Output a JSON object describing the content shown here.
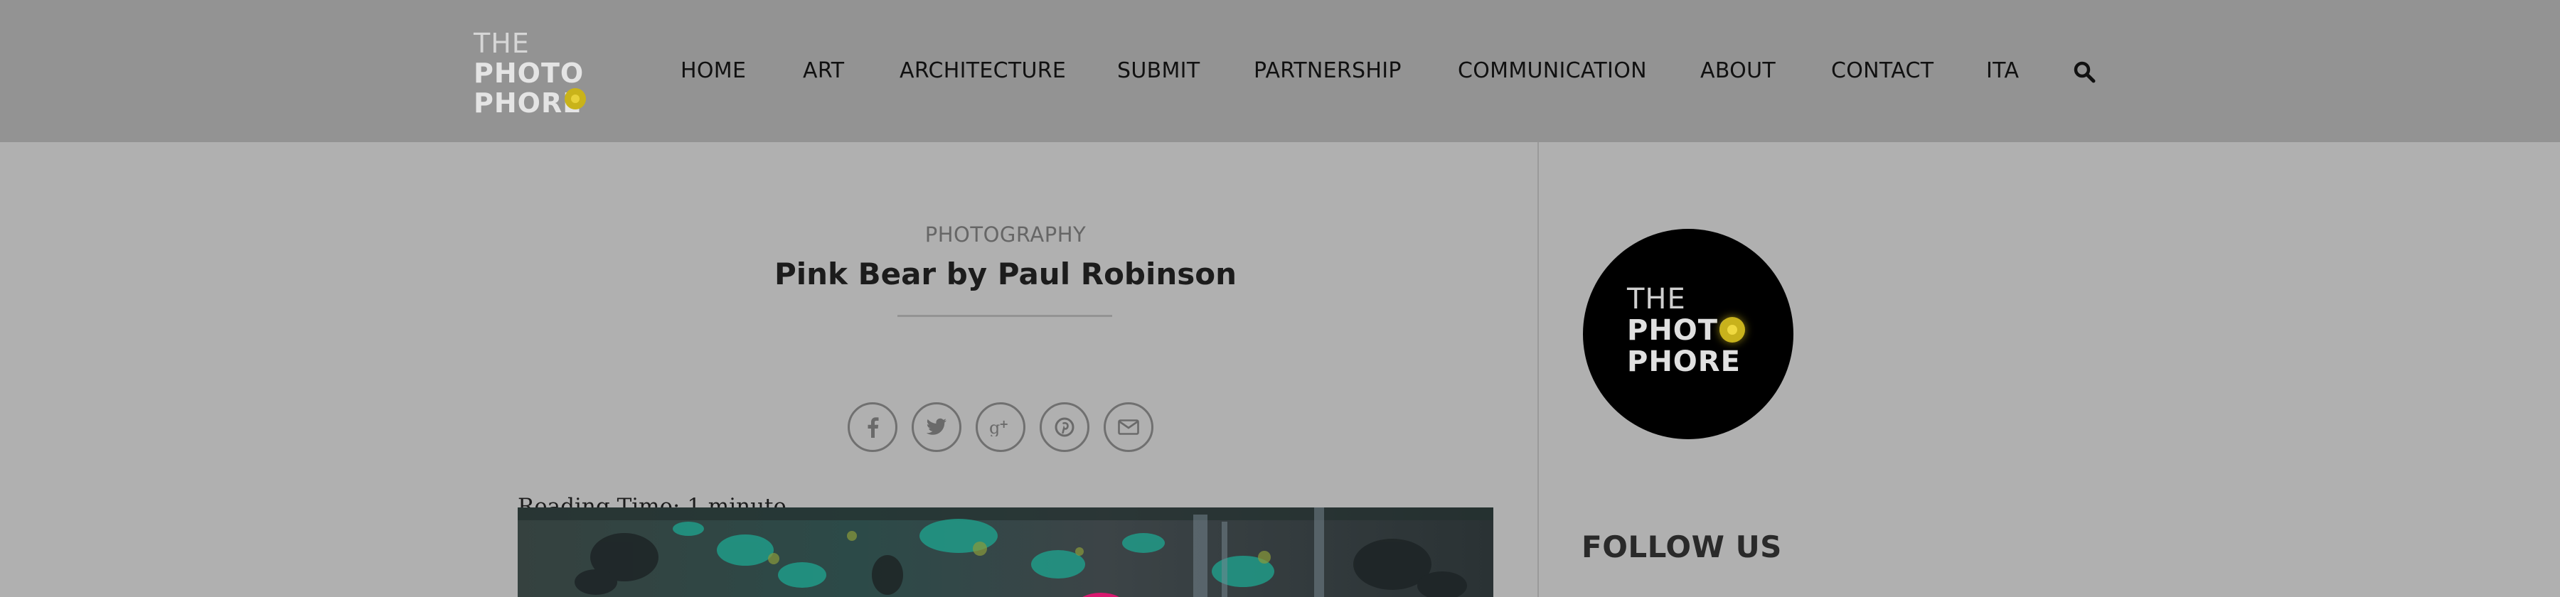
{
  "header": {
    "logo": {
      "line1": "THE",
      "line2": "PHOTO",
      "line3": "PHORE",
      "accent": "#c9b31a"
    },
    "nav": [
      {
        "label": "HOME"
      },
      {
        "label": "ART"
      },
      {
        "label": "ARCHITECTURE"
      },
      {
        "label": "SUBMIT"
      },
      {
        "label": "PARTNERSHIP"
      },
      {
        "label": "COMMUNICATION"
      },
      {
        "label": "ABOUT"
      },
      {
        "label": "CONTACT"
      },
      {
        "label": "ITA"
      }
    ],
    "search_icon": "search-icon"
  },
  "article": {
    "category": "PHOTOGRAPHY",
    "title": "Pink Bear by Paul Robinson",
    "share_icons": [
      "facebook-icon",
      "twitter-icon",
      "google-plus-icon",
      "pinterest-icon",
      "envelope-icon"
    ],
    "reading_time": "Reading Time: 1 minute"
  },
  "sidebar": {
    "logo": {
      "line1": "THE",
      "line2": "PHOTO",
      "line3": "PHORE"
    },
    "follow_heading": "FOLLOW US"
  },
  "colors": {
    "header_bg": "#939393",
    "page_bg": "#b0b0b0",
    "logo_accent": "#c9b31a"
  }
}
